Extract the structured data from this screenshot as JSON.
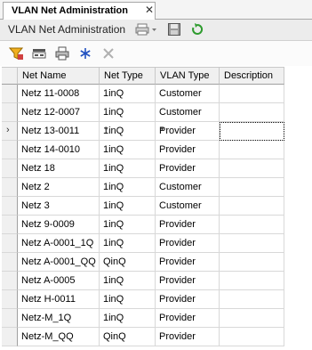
{
  "tab": {
    "label": "VLAN Net Administration",
    "close": "✕"
  },
  "header": {
    "title": "VLAN Net Administration"
  },
  "grid": {
    "columns": [
      "Net Name",
      "Net Type",
      "VLAN Type",
      "Description"
    ],
    "rows": [
      [
        "Netz 11-0008",
        "1inQ",
        "Customer",
        ""
      ],
      [
        "Netz 12-0007",
        "1inQ",
        "Customer",
        ""
      ],
      [
        "Netz 13-0011",
        "1inQ",
        "Provider",
        ""
      ],
      [
        "Netz 14-0010",
        "1inQ",
        "Provider",
        ""
      ],
      [
        "Netz 18",
        "1inQ",
        "Provider",
        ""
      ],
      [
        "Netz 2",
        "1inQ",
        "Customer",
        ""
      ],
      [
        "Netz 3",
        "1inQ",
        "Customer",
        ""
      ],
      [
        "Netz 9-0009",
        "1inQ",
        "Provider",
        ""
      ],
      [
        "Netz A-0001_1Q",
        "1inQ",
        "Provider",
        ""
      ],
      [
        "Netz A-0001_QQ",
        "QinQ",
        "Provider",
        ""
      ],
      [
        "Netz A-0005",
        "1inQ",
        "Provider",
        ""
      ],
      [
        "Netz H-0011",
        "1inQ",
        "Provider",
        ""
      ],
      [
        "Netz-M_1Q",
        "1inQ",
        "Provider",
        ""
      ],
      [
        "Netz-M_QQ",
        "QinQ",
        "Provider",
        ""
      ]
    ],
    "current_row": 2,
    "current_row_marker": "›"
  },
  "colors": {
    "header_bg": "#ececec",
    "grid_header_bg": "#f0f0f0",
    "accent_green": "#2e9b2e"
  }
}
